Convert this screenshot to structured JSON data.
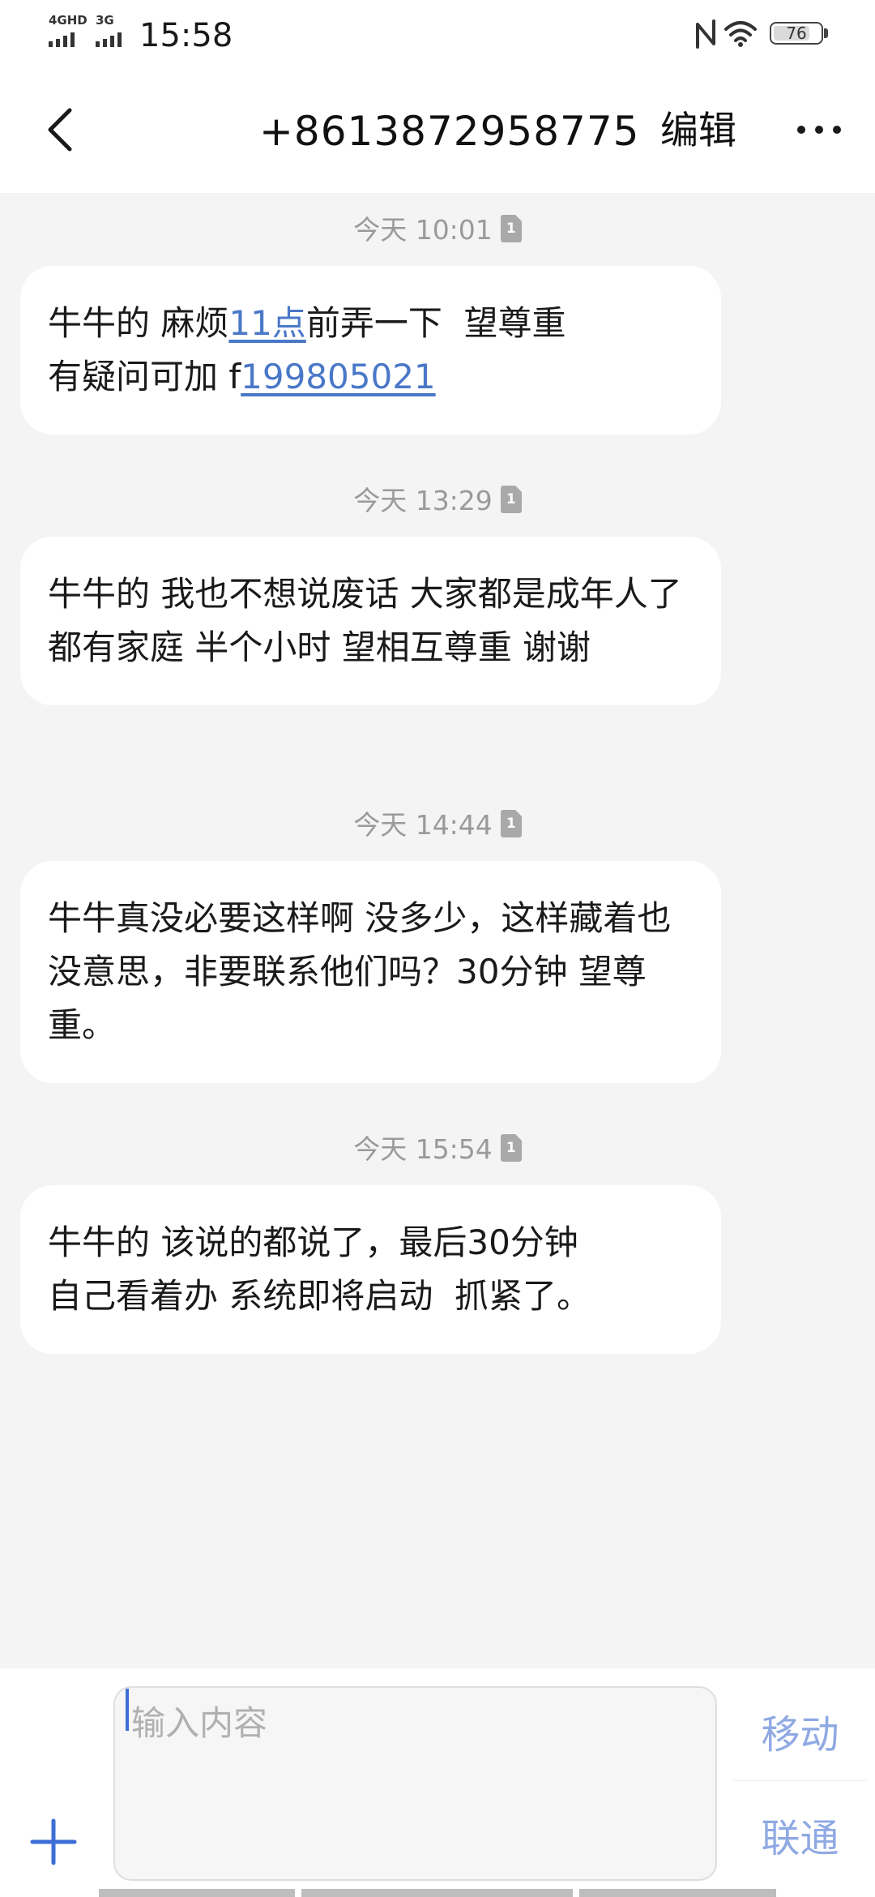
{
  "status_bar": {
    "network_1": "4GHD",
    "network_2": "3G",
    "time": "15:58",
    "battery": "76",
    "icons": [
      "nfc-icon",
      "wifi-icon",
      "battery-icon"
    ]
  },
  "header": {
    "back_icon": "chevron-left-icon",
    "title": "+8613872958775",
    "edit_label": "编辑",
    "more_icon": "more-horizontal-icon"
  },
  "messages": [
    {
      "time": "今天 10:01",
      "sim": "1",
      "parts": [
        {
          "text": "牛牛的  麻烦",
          "link": false
        },
        {
          "text": "11点",
          "link": true
        },
        {
          "text": "前弄一下  望尊重\n有疑问可加 f",
          "link": false
        },
        {
          "text": "199805021",
          "link": true
        }
      ]
    },
    {
      "time": "今天 13:29",
      "sim": "1",
      "parts": [
        {
          "text": "牛牛的 我也不想说废话 大家都是成年人了 都有家庭 半个小时  望相互尊重 谢谢",
          "link": false
        }
      ]
    },
    {
      "time": "今天 14:44",
      "sim": "1",
      "parts": [
        {
          "text": "牛牛真没必要这样啊 没多少，这样藏着也没意思，非要联系他们吗？30分钟  望尊重。",
          "link": false
        }
      ]
    },
    {
      "time": "今天 15:54",
      "sim": "1",
      "parts": [
        {
          "text": "牛牛的 该说的都说了，最后30分钟\n自己看着办 系统即将启动  抓紧了。",
          "link": false
        }
      ]
    }
  ],
  "composer": {
    "attach_icon": "plus-icon",
    "value": "",
    "placeholder": "输入内容",
    "send_sim1_label": "移动",
    "send_sim2_label": "联通"
  },
  "colors": {
    "link": "#4a78c8",
    "send_label": "#8fa9e3",
    "caret": "#3c6fd6",
    "background": "#f4f4f4",
    "bubble": "#ffffff"
  }
}
